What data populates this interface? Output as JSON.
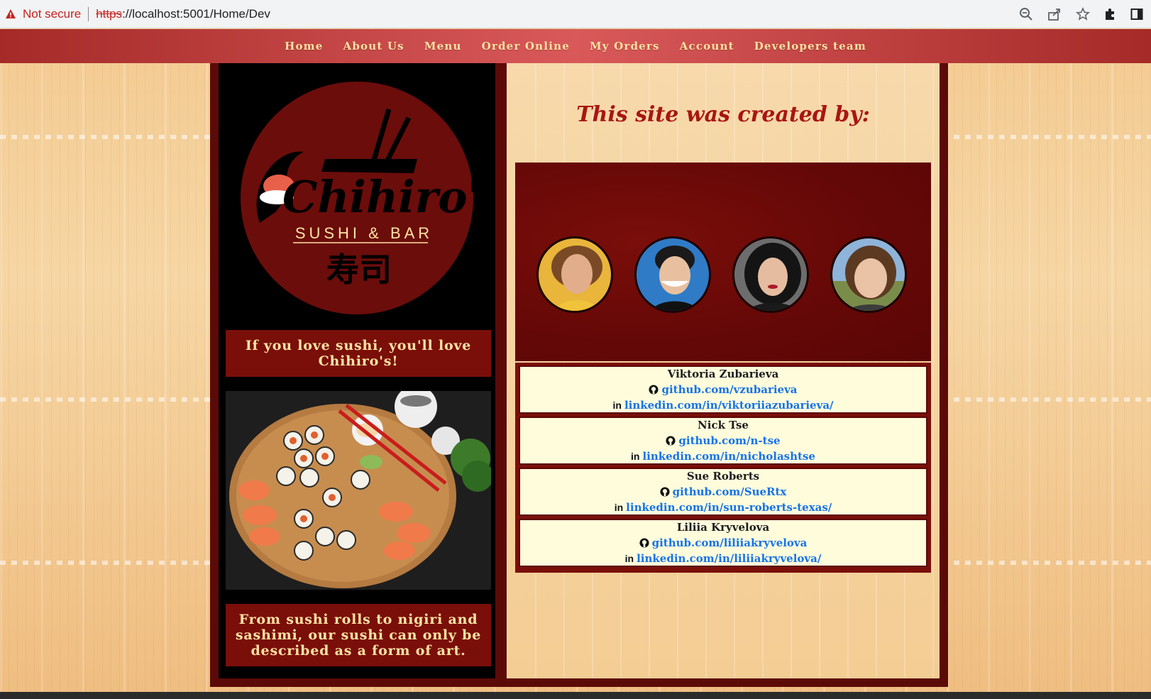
{
  "browser": {
    "security_label": "Not secure",
    "url_scheme": "https",
    "url_rest": "://localhost:5001/Home/Dev",
    "icons": [
      "warning-icon",
      "zoom-icon",
      "share-icon",
      "star-icon",
      "extensions-icon",
      "side-panel-icon"
    ]
  },
  "nav": {
    "items": [
      "Home",
      "About Us",
      "Menu",
      "Order Online",
      "My Orders",
      "Account",
      "Developers team"
    ]
  },
  "left": {
    "logo_text": "Chihiro's",
    "logo_subtitle": "SUSHI & BAR",
    "logo_kanji": "寿司",
    "tagline": "If you love sushi, you'll love Chihiro's!",
    "art_text": "From sushi rolls to nigiri and sashimi, our sushi can only be described as a form of art."
  },
  "page": {
    "heading": "This site was created by:"
  },
  "developers": [
    {
      "name": "Viktoria Zubarieva",
      "github": "github.com/vzubarieva",
      "linkedin": "linkedin.com/in/viktoriiazubarieva/"
    },
    {
      "name": "Nick Tse",
      "github": "github.com/n-tse",
      "linkedin": "linkedin.com/in/nicholashtse"
    },
    {
      "name": "Sue Roberts",
      "github": "github.com/SueRtx",
      "linkedin": "linkedin.com/in/sun-roberts-texas/"
    },
    {
      "name": "Liliia Kryvelova",
      "github": "github.com/liliiakryvelova",
      "linkedin": "linkedin.com/in/liliiakryvelova/"
    }
  ],
  "colors": {
    "nav_text": "#ffe3a3",
    "heading": "#a81612",
    "link": "#1673e6",
    "frame": "#5c0a08",
    "card_bg": "#fffcdc"
  }
}
